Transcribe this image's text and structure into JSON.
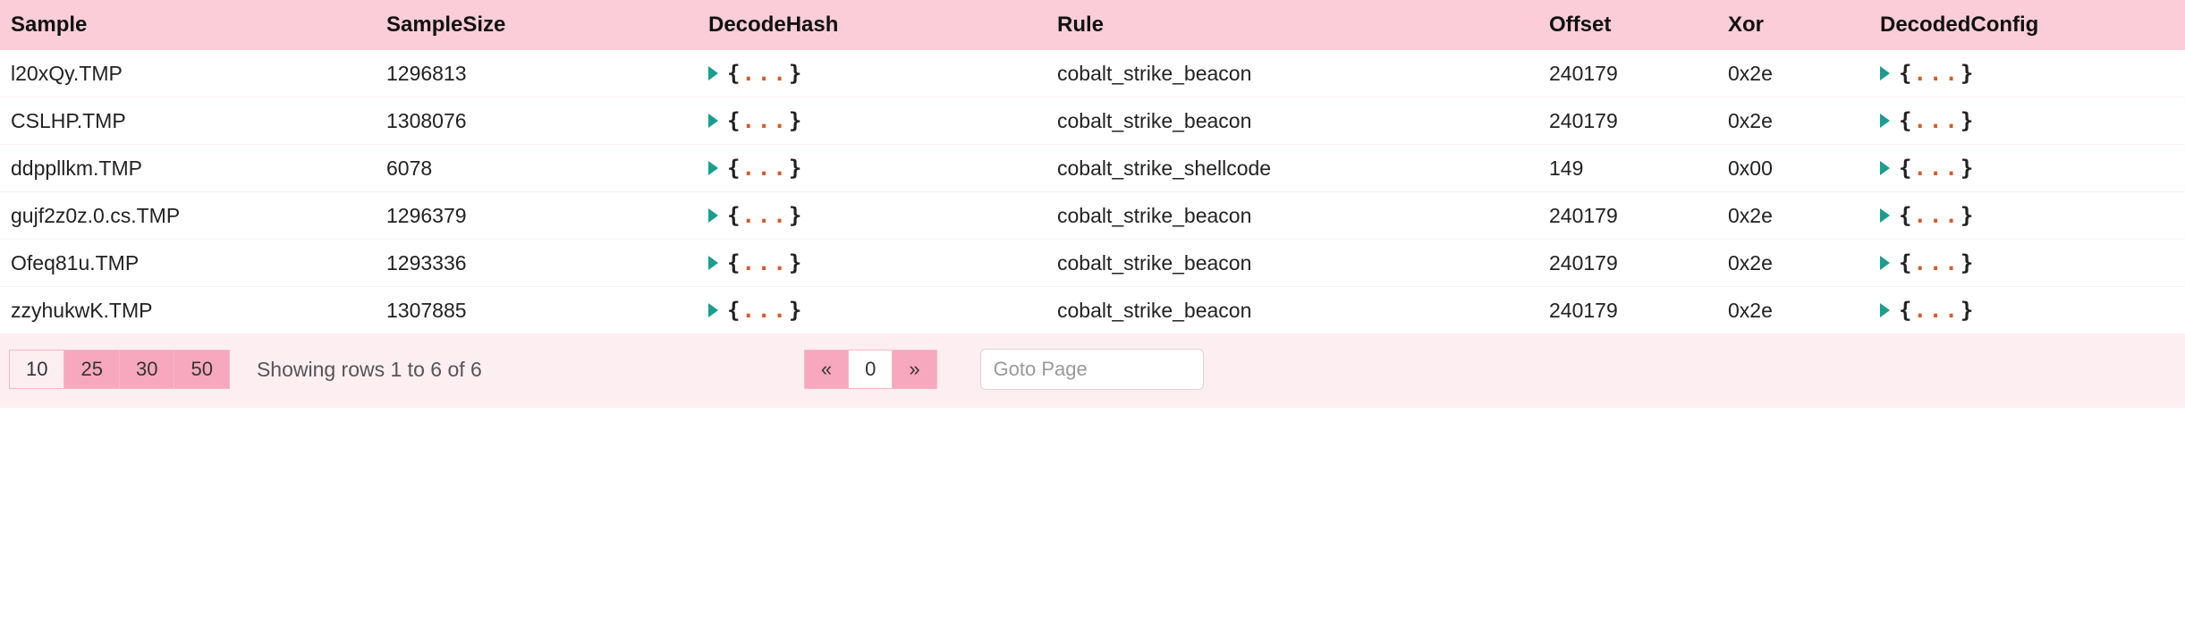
{
  "table": {
    "headers": {
      "sample": "Sample",
      "sampleSize": "SampleSize",
      "decodeHash": "DecodeHash",
      "rule": "Rule",
      "offset": "Offset",
      "xor": "Xor",
      "decodedConfig": "DecodedConfig"
    },
    "collapsed_brace_left": "{",
    "collapsed_brace_right": "}",
    "collapsed_dots": "...",
    "rows": [
      {
        "sample": "l20xQy.TMP",
        "sampleSize": "1296813",
        "rule": "cobalt_strike_beacon",
        "offset": "240179",
        "xor": "0x2e"
      },
      {
        "sample": "CSLHP.TMP",
        "sampleSize": "1308076",
        "rule": "cobalt_strike_beacon",
        "offset": "240179",
        "xor": "0x2e"
      },
      {
        "sample": "ddppllkm.TMP",
        "sampleSize": "6078",
        "rule": "cobalt_strike_shellcode",
        "offset": "149",
        "xor": "0x00"
      },
      {
        "sample": "gujf2z0z.0.cs.TMP",
        "sampleSize": "1296379",
        "rule": "cobalt_strike_beacon",
        "offset": "240179",
        "xor": "0x2e"
      },
      {
        "sample": "Ofeq81u.TMP",
        "sampleSize": "1293336",
        "rule": "cobalt_strike_beacon",
        "offset": "240179",
        "xor": "0x2e"
      },
      {
        "sample": "zzyhukwK.TMP",
        "sampleSize": "1307885",
        "rule": "cobalt_strike_beacon",
        "offset": "240179",
        "xor": "0x2e"
      }
    ]
  },
  "footer": {
    "pageSizes": [
      "10",
      "25",
      "30",
      "50"
    ],
    "activePageSize": "10",
    "status": "Showing rows 1 to 6 of 6",
    "prevLabel": "«",
    "nextLabel": "»",
    "currentPage": "0",
    "gotoPlaceholder": "Goto Page"
  }
}
